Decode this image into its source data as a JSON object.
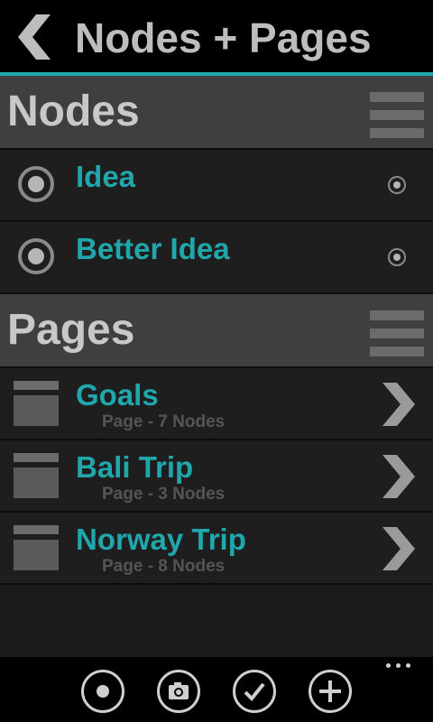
{
  "header": {
    "title": "Nodes + Pages"
  },
  "sections": {
    "nodes": {
      "title": "Nodes",
      "items": [
        {
          "label": "Idea"
        },
        {
          "label": "Better Idea"
        }
      ]
    },
    "pages": {
      "title": "Pages",
      "items": [
        {
          "label": "Goals",
          "subtitle": "Page - 7 Nodes"
        },
        {
          "label": "Bali Trip",
          "subtitle": "Page - 3 Nodes"
        },
        {
          "label": "Norway Trip",
          "subtitle": "Page - 8 Nodes"
        }
      ]
    }
  },
  "appbar": {
    "buttons": [
      "record-icon",
      "camera-icon",
      "check-icon",
      "add-icon"
    ],
    "more": "ellipsis-icon"
  },
  "colors": {
    "accent": "#1fa7ab",
    "header_bg": "#3f3f3f",
    "row_bg": "#1e1e1e"
  }
}
